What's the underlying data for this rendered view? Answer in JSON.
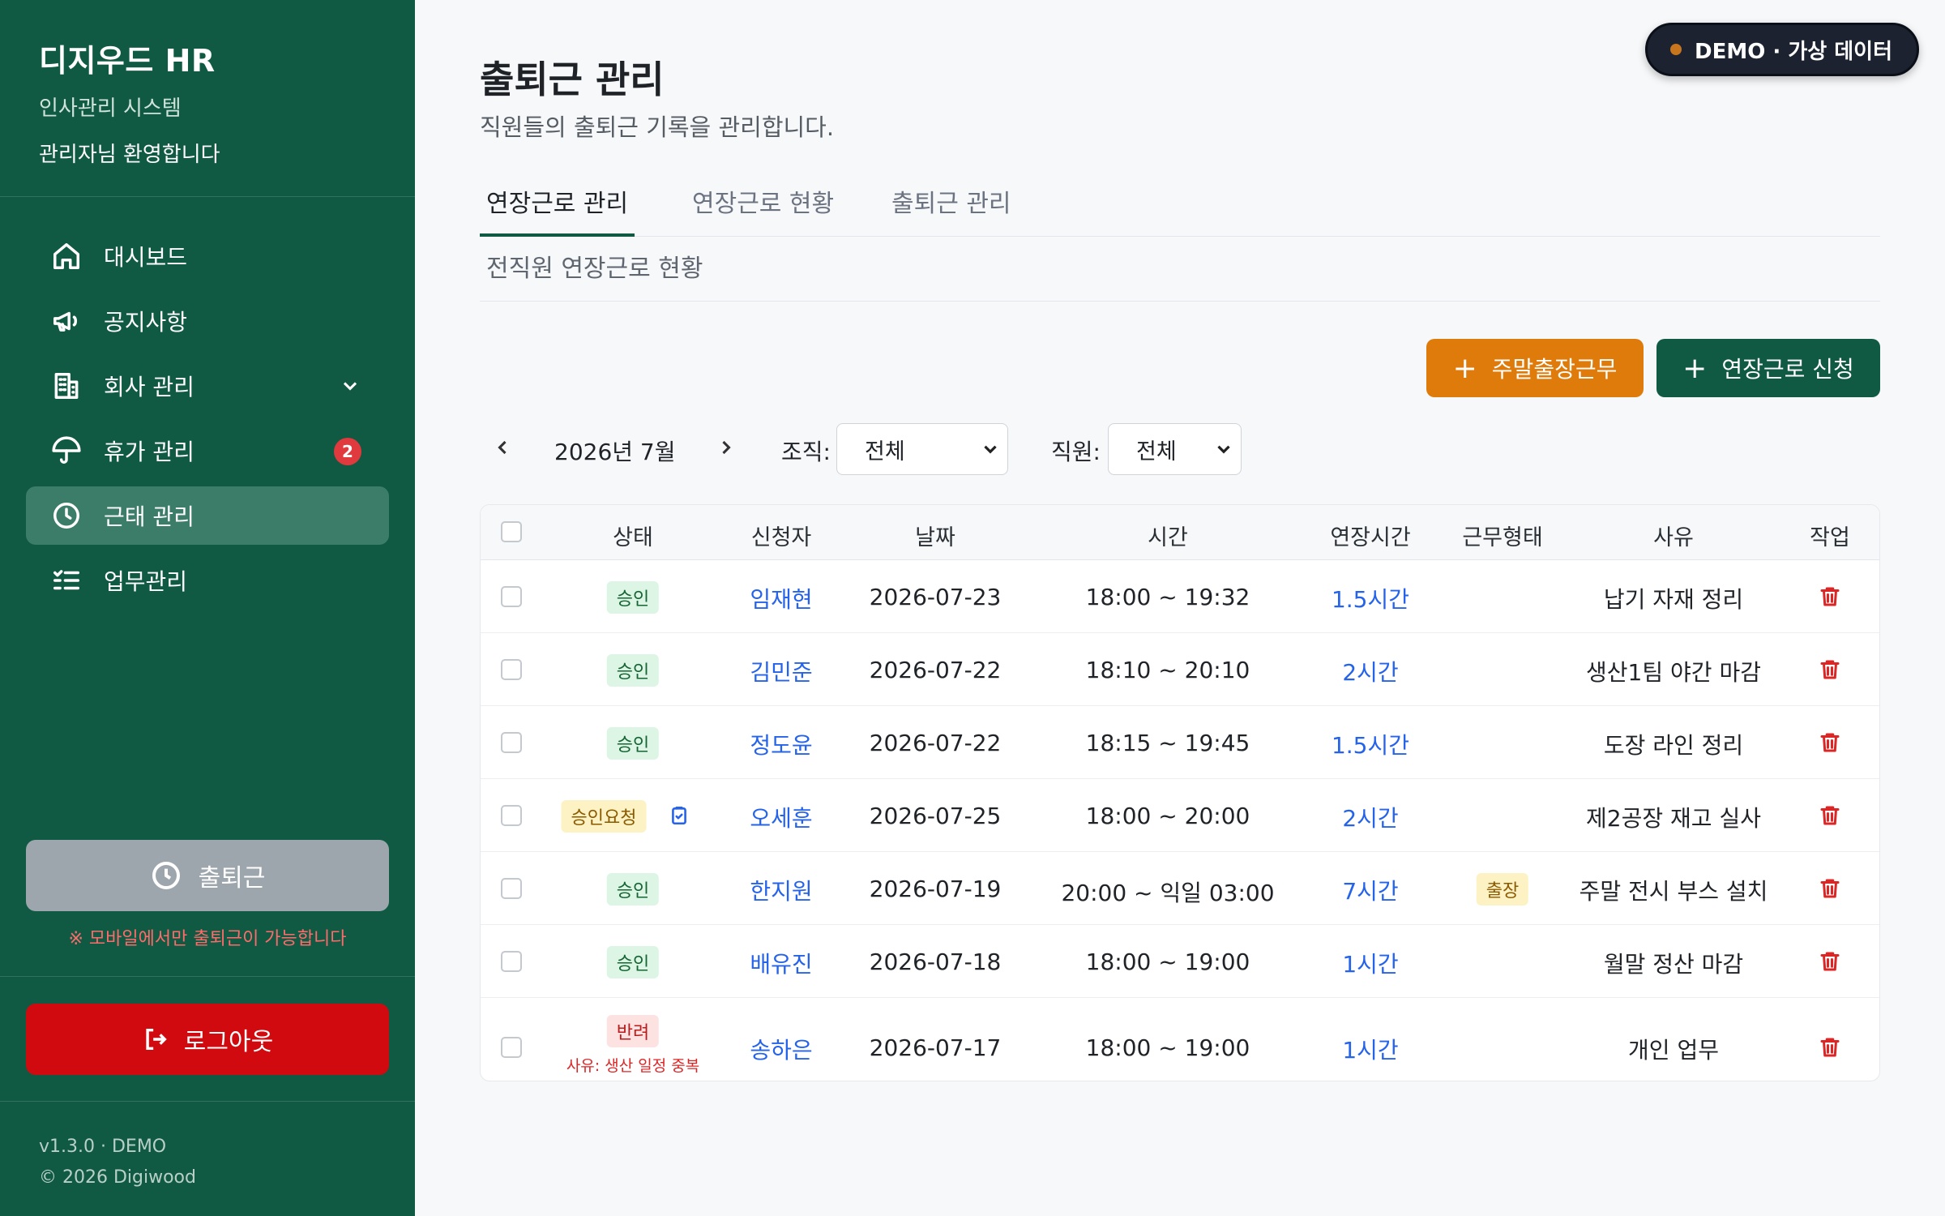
{
  "sidebar": {
    "brand_name": "디지우드 HR",
    "brand_sub": "인사관리 시스템",
    "welcome": "관리자님 환영합니다",
    "items": [
      {
        "label": "대시보드",
        "icon": "home-icon"
      },
      {
        "label": "공지사항",
        "icon": "megaphone-icon"
      },
      {
        "label": "회사 관리",
        "icon": "building-icon",
        "has_chevron": true
      },
      {
        "label": "휴가 관리",
        "icon": "umbrella-icon",
        "badge": "2"
      },
      {
        "label": "근태 관리",
        "icon": "clock-icon",
        "active": true
      },
      {
        "label": "업무관리",
        "icon": "task-list-icon"
      }
    ],
    "checkin_label": "출퇴근",
    "mobile_note": "※ 모바일에서만 출퇴근이 가능합니다",
    "logout_label": "로그아웃",
    "version": "v1.3.0 · DEMO",
    "copyright": "© 2026 Digiwood"
  },
  "demo_badge": "DEMO · 가상 데이터",
  "header": {
    "title": "출퇴근 관리",
    "subtitle": "직원들의 출퇴근 기록을 관리합니다."
  },
  "tabs": [
    "연장근로 관리",
    "연장근로 현황",
    "출퇴근 관리"
  ],
  "active_tab": 0,
  "subtab": "전직원 연장근로 현황",
  "actions": {
    "weekend_trip": "주말출장근무",
    "overtime_request": "연장근로 신청"
  },
  "filters": {
    "month": "2026년 7월",
    "org_label": "조직:",
    "org_value": "전체",
    "employee_label": "직원:",
    "employee_value": "전체"
  },
  "table": {
    "columns": [
      "상태",
      "신청자",
      "날짜",
      "시간",
      "연장시간",
      "근무형태",
      "사유",
      "작업"
    ],
    "rows": [
      {
        "status": "승인",
        "status_type": "ok",
        "applicant": "임재현",
        "date": "2026-07-23",
        "time": "18:00 ~ 19:32",
        "overtime": "1.5시간",
        "work_type": "",
        "reason": "납기 자재 정리"
      },
      {
        "status": "승인",
        "status_type": "ok",
        "applicant": "김민준",
        "date": "2026-07-22",
        "time": "18:10 ~ 20:10",
        "overtime": "2시간",
        "work_type": "",
        "reason": "생산1팀 야간 마감"
      },
      {
        "status": "승인",
        "status_type": "ok",
        "applicant": "정도윤",
        "date": "2026-07-22",
        "time": "18:15 ~ 19:45",
        "overtime": "1.5시간",
        "work_type": "",
        "reason": "도장 라인 정리"
      },
      {
        "status": "승인요청",
        "status_type": "req",
        "applicant": "오세훈",
        "date": "2026-07-25",
        "time": "18:00 ~ 20:00",
        "overtime": "2시간",
        "work_type": "",
        "reason": "제2공장 재고 실사"
      },
      {
        "status": "승인",
        "status_type": "ok",
        "applicant": "한지원",
        "date": "2026-07-19",
        "time": "20:00 ~ 익일 03:00",
        "overtime": "7시간",
        "work_type": "출장",
        "reason": "주말 전시 부스 설치"
      },
      {
        "status": "승인",
        "status_type": "ok",
        "applicant": "배유진",
        "date": "2026-07-18",
        "time": "18:00 ~ 19:00",
        "overtime": "1시간",
        "work_type": "",
        "reason": "월말 정산 마감"
      },
      {
        "status": "반려",
        "status_type": "rej",
        "reject_note": "사유: 생산 일정 중복",
        "applicant": "송하은",
        "date": "2026-07-17",
        "time": "18:00 ~ 19:00",
        "overtime": "1시간",
        "work_type": "",
        "reason": "개인 업무"
      }
    ]
  },
  "colors": {
    "sidebar": "#105a44",
    "active_nav": "#3c7d69",
    "weekend_button": "#de7b0b",
    "overtime_button": "#105a44",
    "logout_button": "#d10a0f",
    "link": "#2563eb",
    "delete": "#dc2626"
  }
}
